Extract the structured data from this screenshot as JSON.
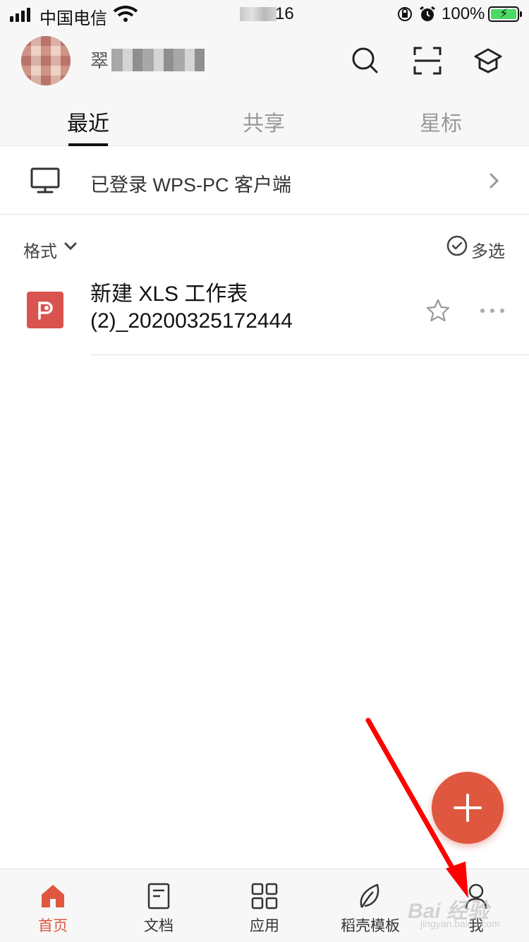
{
  "status_bar": {
    "carrier": "中国电信",
    "time": "16",
    "battery": "100%"
  },
  "header": {
    "username": "翠",
    "tabs": [
      {
        "label": "最近",
        "active": true
      },
      {
        "label": "共享",
        "active": false
      },
      {
        "label": "星标",
        "active": false
      }
    ]
  },
  "pc_login": {
    "text": "已登录 WPS-PC 客户端",
    "icon": "monitor-icon"
  },
  "filter": {
    "format_label": "格式",
    "multi_select_label": "多选"
  },
  "files": [
    {
      "name_line1": "新建 XLS 工作表",
      "name_line2": "(2)_20200325172444",
      "icon": "wps-presentation-icon",
      "icon_color": "#d9534f",
      "starred": false
    }
  ],
  "fab": {
    "icon": "plus-icon",
    "color": "#e0573f"
  },
  "bottom_nav": [
    {
      "label": "首页",
      "icon": "home-icon",
      "active": true
    },
    {
      "label": "文档",
      "icon": "document-icon",
      "active": false
    },
    {
      "label": "应用",
      "icon": "grid-apps-icon",
      "active": false
    },
    {
      "label": "稻壳模板",
      "icon": "leaf-icon",
      "active": false
    },
    {
      "label": "我",
      "icon": "person-icon",
      "active": false
    }
  ],
  "watermark": {
    "text": "Bai 经验",
    "sub": "jingyan.baidu.com"
  },
  "colors": {
    "accent": "#e0573f",
    "annotation_arrow": "#ff0000"
  }
}
